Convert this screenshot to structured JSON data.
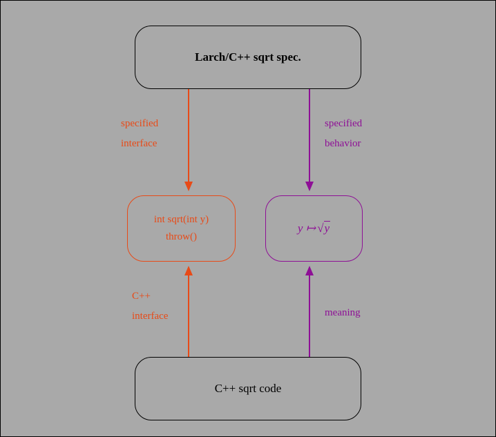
{
  "nodes": {
    "top": "Larch/C++ sqrt spec.",
    "left_line1": "int sqrt(int y)",
    "left_line2": "throw()",
    "right_var": "y",
    "right_maps": "↦",
    "right_rad": "y",
    "bottom": "C++ sqrt code"
  },
  "labels": {
    "top_left_1": "specified",
    "top_left_2": "interface",
    "top_right_1": "specified",
    "top_right_2": "behavior",
    "bot_left_1": "C++",
    "bot_left_2": "interface",
    "bot_right": "meaning"
  },
  "colors": {
    "orange": "#e84a17",
    "purple": "#8e0f96"
  }
}
